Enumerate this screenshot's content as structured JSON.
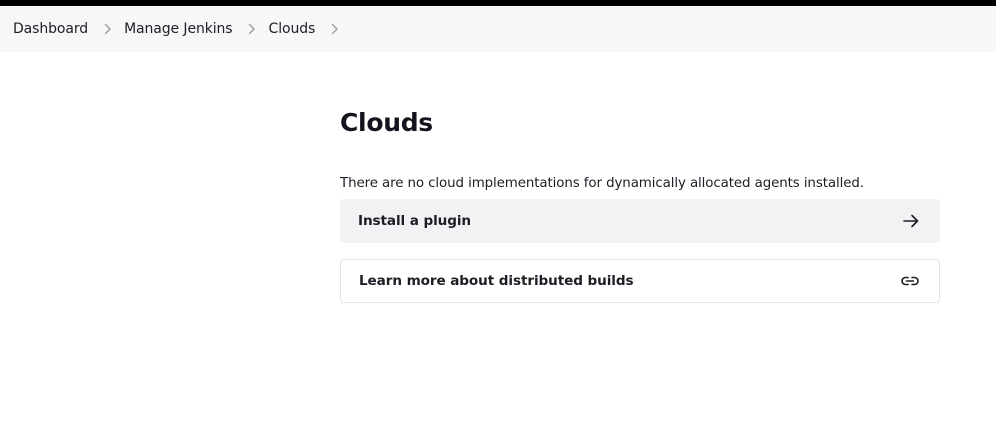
{
  "breadcrumb": {
    "items": [
      {
        "label": "Dashboard"
      },
      {
        "label": "Manage Jenkins"
      },
      {
        "label": "Clouds"
      }
    ],
    "separator_icon": "chevron-right-icon"
  },
  "page": {
    "title": "Clouds",
    "description": "There are no cloud implementations for dynamically allocated agents installed."
  },
  "actions": {
    "install": {
      "label": "Install a plugin",
      "icon": "arrow-right-icon"
    },
    "learn": {
      "label": "Learn more about distributed builds",
      "icon": "link-icon"
    }
  },
  "colors": {
    "top_strip": "#000000",
    "breadcrumb_bg": "#f7f7f8",
    "card_bg": "#f2f2f5",
    "text": "#14141f"
  }
}
